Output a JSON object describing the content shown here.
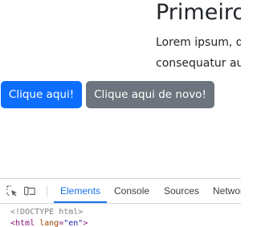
{
  "page": {
    "heading": "Primeiro",
    "paragraph_line1": "Lorem ipsum, do",
    "paragraph_line2": "consequatur aut",
    "button_primary": "Clique aqui!",
    "button_secondary": "Clique aqui de novo!"
  },
  "devtools": {
    "icons": [
      "inspect-element-icon",
      "device-toolbar-icon"
    ],
    "tabs": [
      {
        "label": "Elements",
        "active": true
      },
      {
        "label": "Console",
        "active": false
      },
      {
        "label": "Sources",
        "active": false
      },
      {
        "label": "Network",
        "active": false
      }
    ],
    "code": {
      "doctype": "<!DOCTYPE html>",
      "html_open_start": "<html ",
      "html_attr_name": "lang",
      "html_attr_eq": "=",
      "html_attr_value": "\"en\"",
      "html_open_end": ">"
    }
  },
  "colors": {
    "primary": "#0d6efd",
    "secondary": "#6c757d",
    "devtools_accent": "#1a73e8"
  }
}
